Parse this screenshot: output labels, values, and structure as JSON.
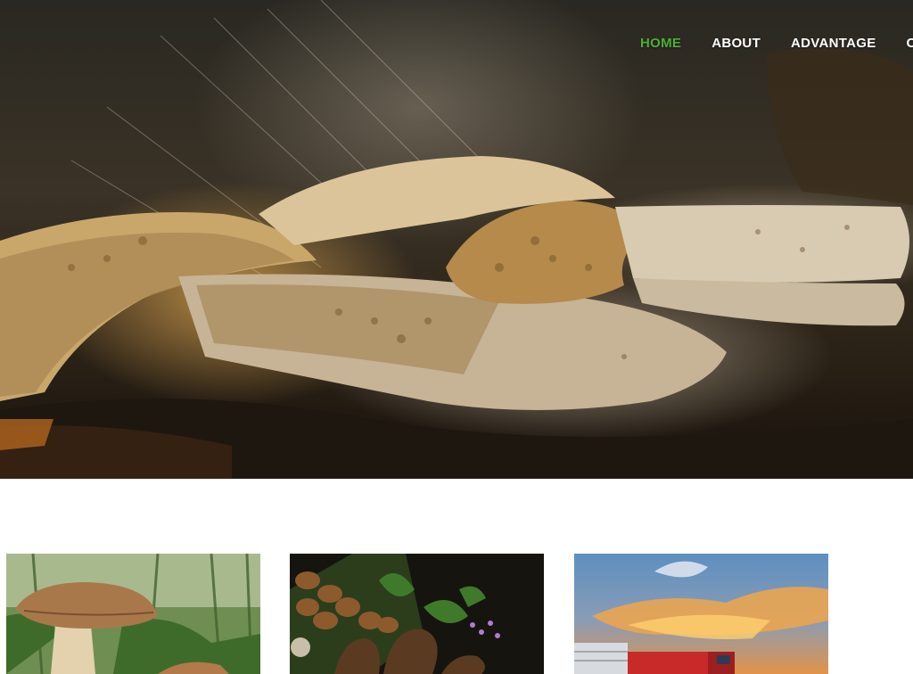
{
  "nav": {
    "items": [
      {
        "label": "HOME",
        "active": true
      },
      {
        "label": "ABOUT",
        "active": false
      },
      {
        "label": "ADVANTAGE",
        "active": false
      },
      {
        "label": "C",
        "active": false
      }
    ],
    "active_color": "#4caf33",
    "text_color": "#ffffff"
  },
  "hero": {
    "image": "mushrooms-in-forest-light-rays"
  },
  "cards": [
    {
      "image": "boletus-mushroom-in-grass"
    },
    {
      "image": "morels-and-mushrooms-arrangement"
    },
    {
      "image": "truck-under-sunset-sky"
    }
  ]
}
